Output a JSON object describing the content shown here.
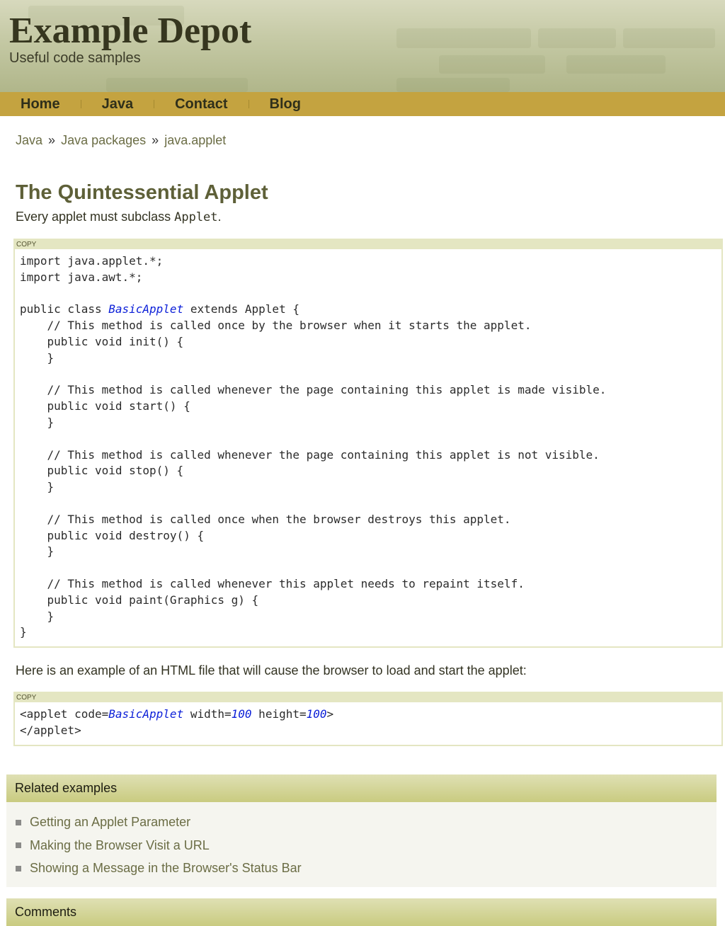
{
  "header": {
    "title": "Example Depot",
    "tagline": "Useful code samples"
  },
  "nav": {
    "items": [
      {
        "label": "Home"
      },
      {
        "label": "Java"
      },
      {
        "label": "Contact"
      },
      {
        "label": "Blog"
      }
    ]
  },
  "breadcrumb": {
    "items": [
      "Java",
      "Java packages",
      "java.applet"
    ],
    "separator": "»"
  },
  "article": {
    "title": "The Quintessential Applet",
    "intro_prefix": "Every applet must subclass ",
    "intro_code": "Applet",
    "intro_suffix": ".",
    "copy_label": "COPY",
    "code_lines": [
      [
        {
          "t": "import java.applet.*;"
        }
      ],
      [
        {
          "t": "import java.awt.*;"
        }
      ],
      [
        {
          "t": ""
        }
      ],
      [
        {
          "t": "public class "
        },
        {
          "t": "BasicApplet",
          "hl": true
        },
        {
          "t": " extends Applet {"
        }
      ],
      [
        {
          "t": "    // This method is called once by the browser when it starts the applet."
        }
      ],
      [
        {
          "t": "    public void init() {"
        }
      ],
      [
        {
          "t": "    }"
        }
      ],
      [
        {
          "t": ""
        }
      ],
      [
        {
          "t": "    // This method is called whenever the page containing this applet is made visible."
        }
      ],
      [
        {
          "t": "    public void start() {"
        }
      ],
      [
        {
          "t": "    }"
        }
      ],
      [
        {
          "t": ""
        }
      ],
      [
        {
          "t": "    // This method is called whenever the page containing this applet is not visible."
        }
      ],
      [
        {
          "t": "    public void stop() {"
        }
      ],
      [
        {
          "t": "    }"
        }
      ],
      [
        {
          "t": ""
        }
      ],
      [
        {
          "t": "    // This method is called once when the browser destroys this applet."
        }
      ],
      [
        {
          "t": "    public void destroy() {"
        }
      ],
      [
        {
          "t": "    }"
        }
      ],
      [
        {
          "t": ""
        }
      ],
      [
        {
          "t": "    // This method is called whenever this applet needs to repaint itself."
        }
      ],
      [
        {
          "t": "    public void paint(Graphics g) {"
        }
      ],
      [
        {
          "t": "    }"
        }
      ],
      [
        {
          "t": "}"
        }
      ]
    ],
    "html_intro": "Here is an example of an HTML file that will cause the browser to load and start the applet:",
    "html_code_lines": [
      [
        {
          "t": "<applet code="
        },
        {
          "t": "BasicApplet",
          "hl": true
        },
        {
          "t": " width="
        },
        {
          "t": "100",
          "hl": true
        },
        {
          "t": " height="
        },
        {
          "t": "100",
          "hl": true
        },
        {
          "t": ">"
        }
      ],
      [
        {
          "t": "</applet>"
        }
      ]
    ]
  },
  "related": {
    "heading": "Related examples",
    "items": [
      "Getting an Applet Parameter",
      "Making the Browser Visit a URL",
      "Showing a Message in the Browser's Status Bar"
    ]
  },
  "comments": {
    "heading": "Comments"
  },
  "colors": {
    "nav_bar": "#c4a340",
    "link": "#6b6d45",
    "title": "#5e6038",
    "code_highlight": "#0a1ed8",
    "copy_bar": "#e4e6c2"
  }
}
